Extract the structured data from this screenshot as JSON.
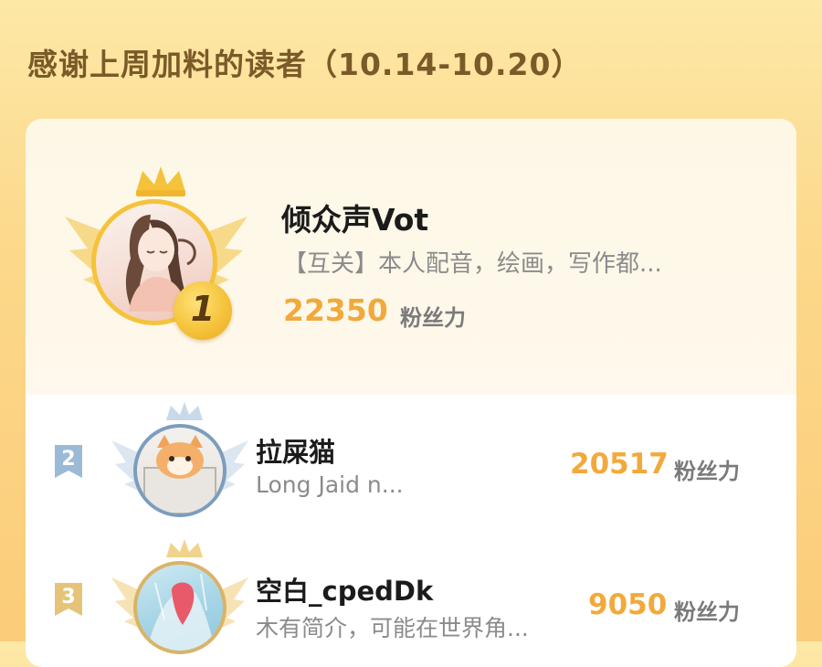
{
  "header": {
    "title": "感谢上周加料的读者（10.14-10.20）"
  },
  "colors": {
    "accent": "#f2a93b",
    "gold": "#f5c33b",
    "silver": "#9bbad6",
    "bronze": "#e5c47a"
  },
  "readers": [
    {
      "rank": "1",
      "name": "倾众声Vot",
      "desc": "【互关】本人配音，绘画，写作都...",
      "score": "22350",
      "unit": "粉丝力"
    },
    {
      "rank": "2",
      "name": "拉屎猫",
      "desc": "Long Jaid n...",
      "score": "20517",
      "unit": "粉丝力"
    },
    {
      "rank": "3",
      "name": "空白_cpedDk",
      "desc": "木有简介，可能在世界角...",
      "score": "9050",
      "unit": "粉丝力"
    }
  ]
}
